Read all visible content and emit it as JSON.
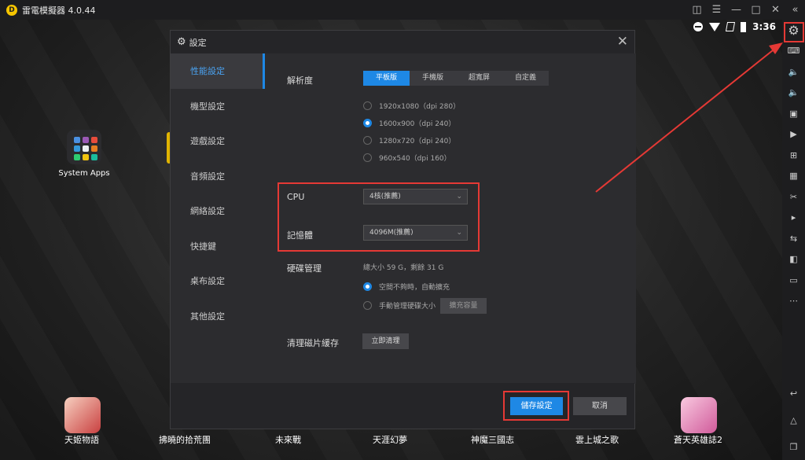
{
  "window": {
    "title": "雷電模擬器 4.0.44",
    "logo_letter": "D",
    "controls": [
      "gamepad-icon",
      "menu-icon",
      "minimize-icon",
      "maximize-icon",
      "close-icon",
      "collapse-icon"
    ]
  },
  "status_bar": {
    "time": "3:36"
  },
  "desktop": {
    "system_apps_label": "System Apps",
    "dock": [
      {
        "label": "天姬物語",
        "color": "#d86a6a"
      },
      {
        "label": "拂曉的拾荒團",
        "color": "#8a8aa6"
      },
      {
        "label": "未來戰",
        "color": "#6a6a6a"
      },
      {
        "label": "天涯幻夢",
        "color": "#6a6a6a"
      },
      {
        "label": "神魔三國志",
        "color": "#6a6a6a"
      },
      {
        "label": "雲上城之歌",
        "color": "#6a6a6a"
      },
      {
        "label": "蒼天英雄誌2",
        "color": "#e88aa8"
      }
    ]
  },
  "dialog": {
    "title": "設定",
    "nav": [
      {
        "label": "性能設定",
        "active": true
      },
      {
        "label": "機型設定",
        "active": false
      },
      {
        "label": "遊戲設定",
        "active": false
      },
      {
        "label": "音頻設定",
        "active": false
      },
      {
        "label": "網絡設定",
        "active": false
      },
      {
        "label": "快捷鍵",
        "active": false
      },
      {
        "label": "桌布設定",
        "active": false
      },
      {
        "label": "其他設定",
        "active": false
      }
    ],
    "resolution": {
      "label": "解析度",
      "tabs": [
        "平板版",
        "手機版",
        "超寬屏",
        "自定義"
      ],
      "active_tab": 0,
      "options": [
        {
          "label": "1920x1080（dpi 280）",
          "selected": false
        },
        {
          "label": "1600x900（dpi 240）",
          "selected": true
        },
        {
          "label": "1280x720（dpi 240）",
          "selected": false
        },
        {
          "label": "960x540（dpi 160）",
          "selected": false
        }
      ]
    },
    "cpu": {
      "label": "CPU",
      "value": "4核(推薦)"
    },
    "memory": {
      "label": "記憶體",
      "value": "4096M(推薦)"
    },
    "disk": {
      "label": "硬碟管理",
      "info": "總大小 59 G，剩餘 31 G",
      "option_auto": "空間不夠時，自動擴充",
      "option_manual": "手動管理硬碟大小",
      "expand_button": "擴充容量"
    },
    "cache": {
      "label": "清理磁片緩存",
      "button": "立即清理"
    },
    "save_button": "儲存設定",
    "cancel_button": "取消"
  }
}
